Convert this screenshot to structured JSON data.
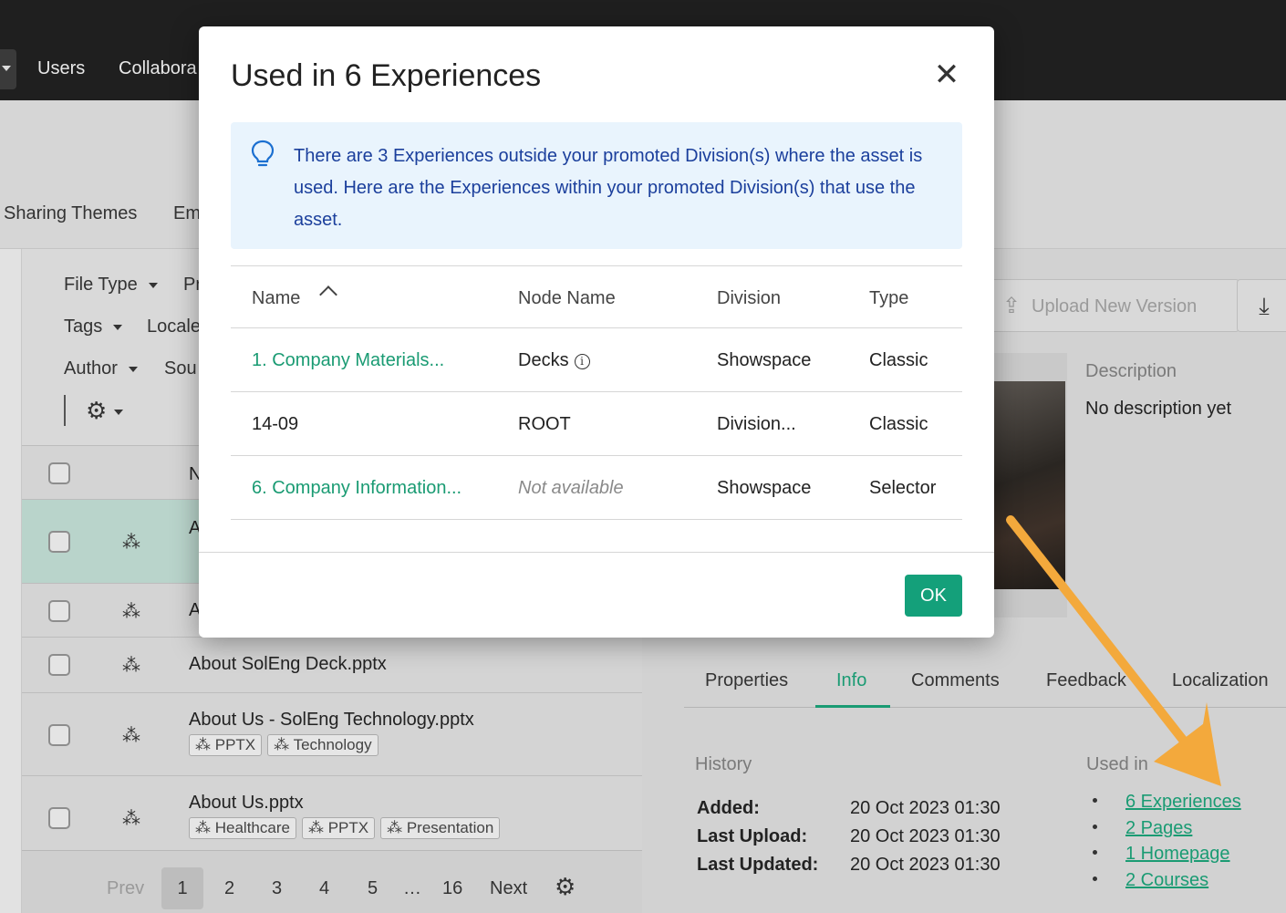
{
  "topbar": {
    "nav": [
      "Users",
      "Collabora"
    ]
  },
  "subhead": {
    "tabs": [
      "Sharing Themes",
      "Em"
    ]
  },
  "filters": [
    {
      "label": "File Type"
    },
    {
      "label": "Pr"
    },
    {
      "label": "Tags"
    },
    {
      "label": "Locale"
    },
    {
      "label": "Author"
    },
    {
      "label": "Sou"
    }
  ],
  "file_table": {
    "header_partial": "N",
    "rows": [
      {
        "name": "A",
        "tags": []
      },
      {
        "name": "A",
        "tags": []
      },
      {
        "name": "About SolEng Deck.pptx",
        "tags": []
      },
      {
        "name": "About Us - SolEng Technology.pptx",
        "tags": [
          "PPTX",
          "Technology"
        ]
      },
      {
        "name": "About Us.pptx",
        "tags": [
          "Healthcare",
          "PPTX",
          "Presentation"
        ]
      }
    ]
  },
  "pager": {
    "prev": "Prev",
    "pages": [
      "1",
      "2",
      "3",
      "4",
      "5",
      "…",
      "16"
    ],
    "next": "Next",
    "current": "1"
  },
  "right_pane": {
    "upload_label": "Upload New Version",
    "description_label": "Description",
    "description_text": "No description yet",
    "tabs": [
      "Properties",
      "Info",
      "Comments",
      "Feedback",
      "Localization"
    ],
    "active_tab": "Info",
    "history_label": "History",
    "history": [
      {
        "key": "Added:",
        "value": "20 Oct 2023 01:30"
      },
      {
        "key": "Last Upload:",
        "value": "20 Oct 2023 01:30"
      },
      {
        "key": "Last Updated:",
        "value": "20 Oct 2023 01:30"
      }
    ],
    "used_in_label": "Used in",
    "used_in": [
      "6 Experiences",
      "2 Pages",
      "1 Homepage",
      "2 Courses"
    ]
  },
  "modal": {
    "title": "Used in 6 Experiences",
    "info_text": "There are 3 Experiences outside your promoted Division(s) where the asset is used. Here are the Experiences within your promoted Division(s) that use the asset.",
    "columns": [
      "Name",
      "Node Name",
      "Division",
      "Type"
    ],
    "rows": [
      {
        "name": "1. Company Materials...",
        "node": "Decks",
        "division": "Showspace",
        "type": "Classic"
      },
      {
        "name": "14-09",
        "node": "ROOT",
        "division": "Division...",
        "type": "Classic"
      },
      {
        "name": "6. Company Information...",
        "node": "Not available",
        "division": "Showspace",
        "type": "Selector"
      }
    ],
    "ok_label": "OK"
  },
  "colors": {
    "accent": "#14a07a",
    "info_bg": "#e9f4fd",
    "info_text": "#1b3f9c",
    "annotation_arrow": "#f3a93c"
  }
}
